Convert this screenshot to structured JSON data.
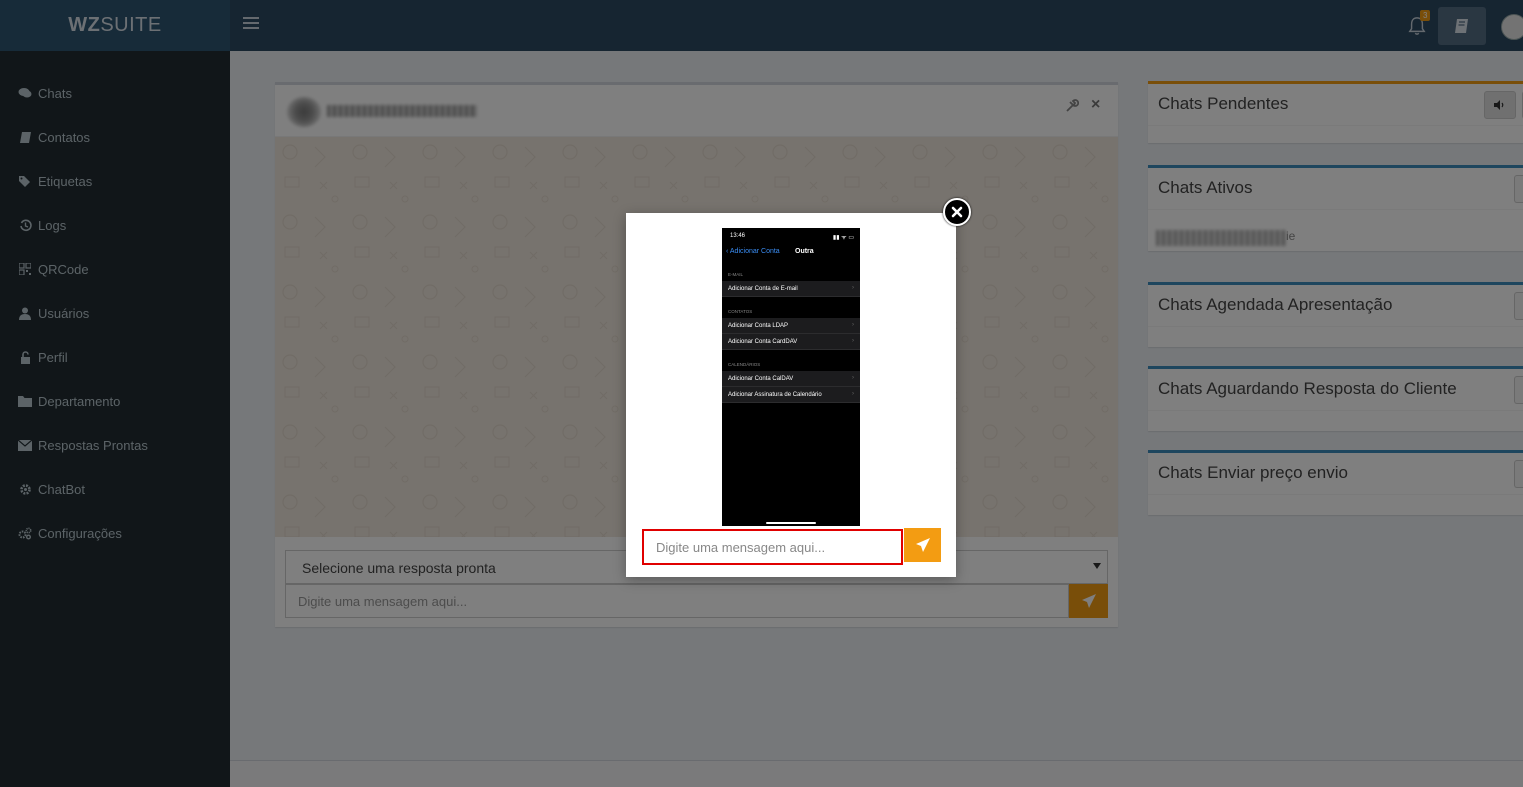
{
  "app": {
    "logo_bold": "WZ",
    "logo_rest": "SUITE"
  },
  "topbar": {
    "notification_count": "3",
    "icons": [
      "menu-icon",
      "bell-icon",
      "notebook-icon",
      "avatar"
    ]
  },
  "sidebar": {
    "items": [
      {
        "label": "Chats",
        "icon": "comments-icon"
      },
      {
        "label": "Contatos",
        "icon": "book-icon"
      },
      {
        "label": "Etiquetas",
        "icon": "tags-icon"
      },
      {
        "label": "Logs",
        "icon": "history-icon"
      },
      {
        "label": "QRCode",
        "icon": "qrcode-icon"
      },
      {
        "label": "Usuários",
        "icon": "user-icon"
      },
      {
        "label": "Perfil",
        "icon": "lock-icon"
      },
      {
        "label": "Departamento",
        "icon": "folder-icon"
      },
      {
        "label": "Respostas Prontas",
        "icon": "envelope-icon"
      },
      {
        "label": "ChatBot",
        "icon": "gear-icon"
      },
      {
        "label": "Configurações",
        "icon": "gears-icon"
      }
    ]
  },
  "chat": {
    "quick_reply_placeholder": "Selecione uma resposta pronta",
    "message_placeholder": "Digite uma mensagem aqui..."
  },
  "panels": {
    "pendentes": "Chats Pendentes",
    "ativos": "Chats Ativos",
    "ativos_item_tail": "ie",
    "agendada": "Chats Agendada Apresentação",
    "aguardando": "Chats Aguardando Resposta do Cliente",
    "enviar": "Chats Enviar preço envio"
  },
  "modal": {
    "message_placeholder": "Digite uma mensagem aqui...",
    "phone": {
      "time": "13:46",
      "status_icons": "▮▮ ᯤ ▭",
      "back": "Adicionar Conta",
      "title": "Outra",
      "sections": [
        {
          "header": "E-MAIL",
          "rows": [
            "Adicionar Conta de E-mail"
          ]
        },
        {
          "header": "CONTATOS",
          "rows": [
            "Adicionar Conta LDAP",
            "Adicionar Conta CardDAV"
          ]
        },
        {
          "header": "CALENDÁRIOS",
          "rows": [
            "Adicionar Conta CalDAV",
            "Adicionar Assinatura de Calendário"
          ]
        }
      ]
    }
  },
  "colors": {
    "accent": "#f39c12",
    "sidebar": "#222d32",
    "topbar": "#2c4a63",
    "panel_border": "#3c8dbc",
    "highlight": "#e00000"
  }
}
